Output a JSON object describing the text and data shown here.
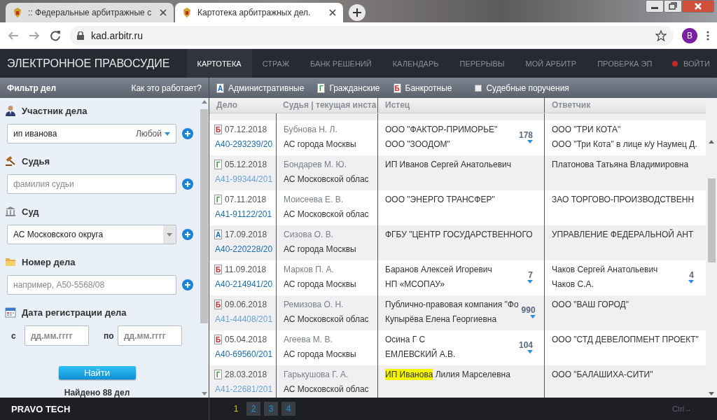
{
  "browser": {
    "tabs": [
      {
        "title": ":: Федеральные арбитражные с",
        "selected": false
      },
      {
        "title": "Картотека арбитражных дел.",
        "selected": true
      }
    ],
    "url": "kad.arbitr.ru",
    "profile_initial": "B"
  },
  "site": {
    "title": "ЭЛЕКТРОННОЕ ПРАВОСУДИЕ",
    "nav": [
      {
        "label": "КАРТОТЕКА",
        "selected": true
      },
      {
        "label": "СТРАЖ",
        "selected": false
      },
      {
        "label": "БАНК РЕШЕНИЙ",
        "selected": false
      },
      {
        "label": "КАЛЕНДАРЬ",
        "selected": false
      },
      {
        "label": "ПЕРЕРЫВЫ",
        "selected": false
      },
      {
        "label": "МОЙ АРБИТР",
        "selected": false
      },
      {
        "label": "ПРОВЕРКА ЭП",
        "selected": false
      }
    ],
    "login": "ВОЙТИ"
  },
  "filter": {
    "title": "Фильтр дел",
    "help_link": "Как это работает?",
    "sections": [
      {
        "kind": "participant",
        "label": "Участник дела",
        "value": "ип иванова",
        "role": "Любой"
      },
      {
        "kind": "judge",
        "label": "Судья",
        "placeholder": "фамилия судьи"
      },
      {
        "kind": "court",
        "label": "Суд",
        "value": "АС Московского округа"
      },
      {
        "kind": "case_number",
        "label": "Номер дела",
        "placeholder": "например, А50-5568/08"
      },
      {
        "kind": "date",
        "label": "Дата регистрации дела",
        "from_label": "с",
        "from_placeholder": "дд.мм.гггг",
        "to_label": "по",
        "to_placeholder": "дд.мм.гггг"
      }
    ],
    "search_button": "Найти",
    "result": "Найдено 88 дел"
  },
  "case_types": [
    {
      "letter": "А",
      "label": "Административные",
      "kind": "administrative"
    },
    {
      "letter": "Г",
      "label": "Гражданские",
      "kind": "civil"
    },
    {
      "letter": "Б",
      "label": "Банкротные",
      "kind": "bankrupt"
    }
  ],
  "court_orders": {
    "label": "Судебные поручения",
    "checked": false
  },
  "table": {
    "columns": [
      "Дело",
      "Судья | текущая инста",
      "Истец",
      "Ответчик"
    ],
    "rows": [
      {
        "type": {
          "letter": "Б",
          "kind": "bankrupt"
        },
        "date": "07.12.2018",
        "number": "А40-293239/20",
        "visited": false,
        "judge": "Бубнова Н. Л.",
        "court": "АС города Москвы",
        "plaintiffs": [
          {
            "text": "ООО \"ФАКТОР-ПРИМОРЬЕ\""
          },
          {
            "text": "ООО \"ЗООДОМ\""
          }
        ],
        "plaintiff_count": "178",
        "defendants": [
          {
            "text": "ООО \"ТРИ КОТА\""
          },
          {
            "text": "ООО \"Три Кота\" в лице к/у Наумец Д."
          }
        ]
      },
      {
        "type": {
          "letter": "Г",
          "kind": "civil"
        },
        "date": "05.12.2018",
        "number": "А41-99344/201",
        "visited": true,
        "judge": "Бондарев М. Ю.",
        "court": "АС Московской облас",
        "plaintiffs": [
          {
            "text": "ИП Иванов Сергей Анатольевич"
          }
        ],
        "defendants": [
          {
            "text": "Платонова Татьяна Владимировна"
          }
        ]
      },
      {
        "type": {
          "letter": "Г",
          "kind": "civil"
        },
        "date": "07.11.2018",
        "number": "А41-91122/201",
        "visited": false,
        "judge": "Моисеева Е. В.",
        "court": "АС Московской облас",
        "plaintiffs": [
          {
            "text": "ООО \"ЭНЕРГО ТРАНСФЕР\""
          }
        ],
        "defendants": [
          {
            "text": "ЗАО ТОРГОВО-ПРОИЗВОДСТВЕНН"
          }
        ]
      },
      {
        "type": {
          "letter": "А",
          "kind": "administrative"
        },
        "date": "17.09.2018",
        "number": "А40-220228/20",
        "visited": false,
        "judge": "Сизова О. В.",
        "court": "АС города Москвы",
        "plaintiffs": [
          {
            "text": "ФГБУ \"ЦЕНТР ГОСУДАРСТВЕННОГО"
          }
        ],
        "defendants": [
          {
            "text": "УПРАВЛЕНИЕ ФЕДЕРАЛЬНОЙ АНТ"
          }
        ]
      },
      {
        "type": {
          "letter": "Б",
          "kind": "bankrupt"
        },
        "date": "11.09.2018",
        "number": "А40-214941/20",
        "visited": false,
        "judge": "Марков П. А.",
        "court": "АС города Москвы",
        "plaintiffs": [
          {
            "text": "Баранов Алексей Игоревич"
          },
          {
            "text": "НП «МСОПАУ»"
          }
        ],
        "plaintiff_count": "7",
        "defendants": [
          {
            "text": "Чаков Сергей Анатольевич"
          },
          {
            "text": "Чаков С.А."
          }
        ],
        "defendant_count": "4"
      },
      {
        "type": {
          "letter": "Б",
          "kind": "bankrupt"
        },
        "date": "09.06.2018",
        "number": "А41-44408/201",
        "visited": true,
        "judge": "Ремизова О. Н.",
        "court": "АС Московской облас",
        "plaintiffs": [
          {
            "text": "Публично-правовая компания \"Фо"
          },
          {
            "text": "Купырёва Елена Георгиевна"
          }
        ],
        "plaintiff_count": "990",
        "defendants": [
          {
            "text": "ООО \"ВАШ ГОРОД\""
          }
        ]
      },
      {
        "type": {
          "letter": "Б",
          "kind": "bankrupt"
        },
        "date": "05.04.2018",
        "number": "А40-69560/201",
        "visited": false,
        "judge": "Агеева М. В.",
        "court": "АС города Москвы",
        "plaintiffs": [
          {
            "text": "Осина Г С"
          },
          {
            "text": "ЕМЛЕВСКИЙ А.В."
          }
        ],
        "plaintiff_count": "104",
        "defendants": [
          {
            "text": "ООО \"СТД ДЕВЕЛОПМЕНТ ПРОЕКТ\""
          }
        ]
      },
      {
        "type": {
          "letter": "Г",
          "kind": "civil"
        },
        "date": "28.03.2018",
        "number": "А41-22681/201",
        "visited": true,
        "judge": "Гарькушова Г. А.",
        "court": "АС Московской облас",
        "plaintiffs": [
          {
            "highlight": "ИП Иванова",
            "text": " Лилия Марселевна"
          }
        ],
        "defendants": [
          {
            "text": "ООО \"БАЛАШИХА-СИТИ\""
          }
        ]
      }
    ]
  },
  "pagination": {
    "pages": [
      {
        "label": "1",
        "selected": true
      },
      {
        "label": "2",
        "selected": false
      },
      {
        "label": "3",
        "selected": false
      },
      {
        "label": "4",
        "selected": false
      }
    ],
    "hint": "Ctrl→"
  },
  "footer_brand": "PRAVO TECH"
}
